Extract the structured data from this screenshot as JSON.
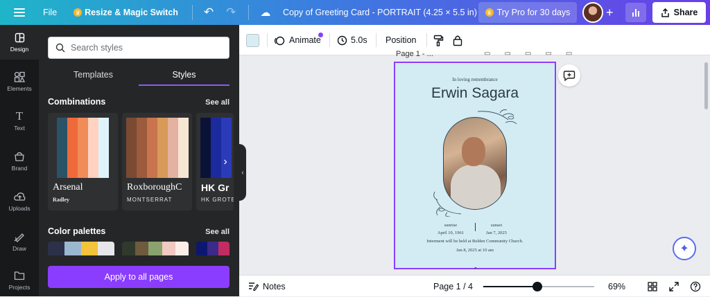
{
  "topbar": {
    "file_label": "File",
    "resize_label": "Resize & Magic Switch",
    "doc_title": "Copy of  Greeting Card - PORTRAIT (4.25 × 5.5 in)",
    "try_pro_label": "Try Pro for 30 days",
    "share_label": "Share",
    "crown_icon": "crown-icon",
    "accent_gradient": [
      "#1fb5c9",
      "#3b7de0",
      "#6a3ee8"
    ]
  },
  "rail": {
    "items": [
      {
        "label": "Design",
        "icon": "design-icon"
      },
      {
        "label": "Elements",
        "icon": "elements-icon"
      },
      {
        "label": "Text",
        "icon": "text-icon"
      },
      {
        "label": "Brand",
        "icon": "brand-icon"
      },
      {
        "label": "Uploads",
        "icon": "uploads-icon"
      },
      {
        "label": "Draw",
        "icon": "draw-icon"
      },
      {
        "label": "Projects",
        "icon": "projects-icon"
      }
    ]
  },
  "panel": {
    "search_placeholder": "Search styles",
    "tabs": [
      "Templates",
      "Styles"
    ],
    "active_tab": "Styles",
    "combinations_title": "Combinations",
    "see_all_label": "See all",
    "combinations": [
      {
        "name": "Arsenal",
        "sub": "Radley",
        "colors": [
          "#2a5368",
          "#ee6a3a",
          "#f08c58",
          "#ffd3c0",
          "#dff3fb"
        ]
      },
      {
        "name": "RoxboroughC",
        "sub": "MONTSERRAT",
        "colors": [
          "#7a4a33",
          "#9b5b3c",
          "#c9744e",
          "#d89a59",
          "#e4b2a0",
          "#f6e6d4"
        ]
      },
      {
        "name": "HK Gr",
        "sub": "HK GROTE",
        "colors": [
          "#0b1238",
          "#1b2a9c",
          "#2b3bb8"
        ]
      }
    ],
    "palettes_title": "Color palettes",
    "palettes": [
      [
        "#2c3048",
        "#9bb8d1",
        "#f2c33b",
        "#e6e7ea"
      ],
      [
        "#2f3a2c",
        "#6e5a3d",
        "#8aa36e",
        "#f0c9c2",
        "#fbeee9"
      ],
      [
        "#0d1770",
        "#3c2a88",
        "#c22c62"
      ]
    ],
    "apply_label": "Apply to all pages",
    "accent": "#8b3dff"
  },
  "toolbar": {
    "animate_label": "Animate",
    "duration_label": "5.0s",
    "position_label": "Position",
    "swatch_color": "#d8ecf3"
  },
  "canvas": {
    "page_label": "Page 1 - ...",
    "card": {
      "kicker": "In loving remembrance",
      "name": "Erwin Sagara",
      "sunrise_label": "sunrise",
      "sunrise_date": "April 10, 1961",
      "sunset_label": "sunset",
      "sunset_date": "Jan 7, 2025",
      "interment": "Interment will be held at Belden Community Church.",
      "service_time": "Jan 8, 2025 at 10 am",
      "background": "#d3ecf4"
    }
  },
  "bottombar": {
    "notes_label": "Notes",
    "page_count": "Page 1 / 4",
    "zoom_value": "69%",
    "zoom_fraction": 0.49
  }
}
